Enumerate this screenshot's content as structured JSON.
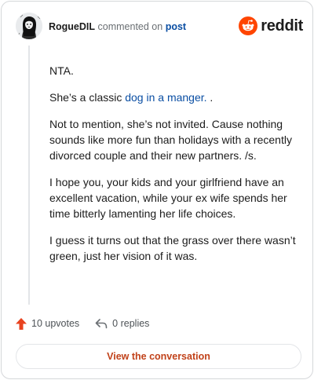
{
  "header": {
    "username": "RogueDIL",
    "action_text": "commented on",
    "post_link": "post",
    "brand_word": "reddit"
  },
  "comment": {
    "p1": "NTA.",
    "p2_prefix": "She’s a classic ",
    "p2_link": "dog in a manger.",
    "p2_suffix": " .",
    "p3": "Not to mention, she’s not invited. Cause nothing sounds like more fun than holidays with a recently divorced couple and their new partners. /s.",
    "p4": "I hope you, your kids and your girlfriend have an excellent vacation, while your ex wife spends her time bitterly lamenting her life choices.",
    "p5": "I guess it turns out that the grass over there wasn’t green, just her vision of it was."
  },
  "actions": {
    "upvotes": "10 upvotes",
    "replies": "0 replies"
  },
  "cta": {
    "label": "View the conversation"
  },
  "colors": {
    "link": "#0a4ea3",
    "upvote": "#e8431f",
    "reddit_orange": "#ff4500",
    "cta_text": "#c1421a"
  },
  "icons": [
    "avatar",
    "reddit-logo-icon",
    "upvote-arrow-icon",
    "reply-icon"
  ]
}
